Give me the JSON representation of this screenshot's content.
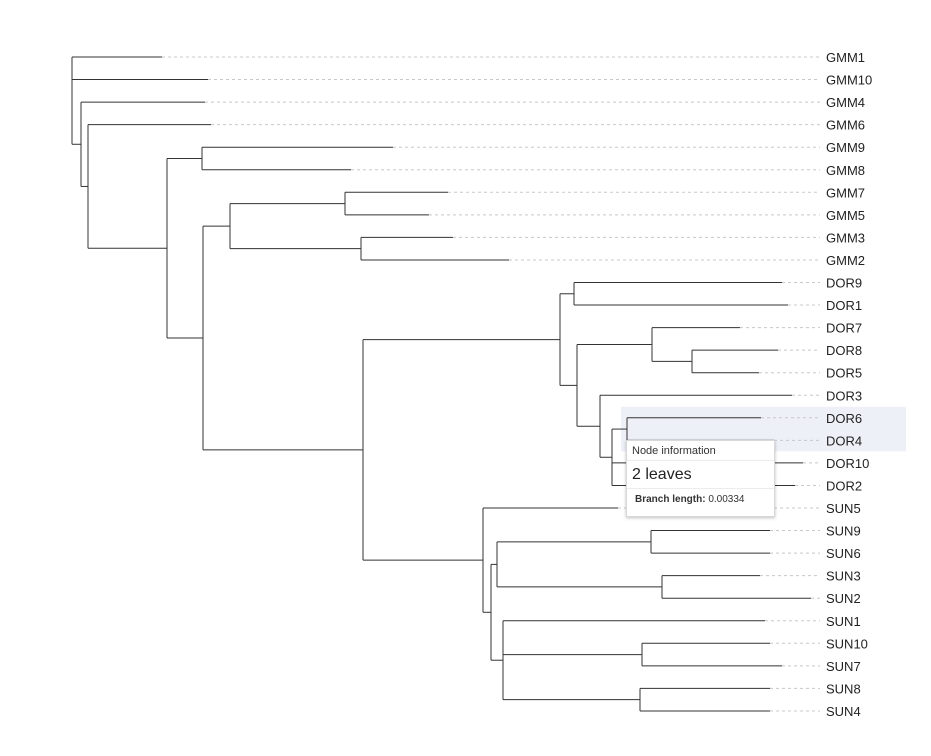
{
  "tree": {
    "leaves": [
      "GMM1",
      "GMM10",
      "GMM4",
      "GMM6",
      "GMM9",
      "GMM8",
      "GMM7",
      "GMM5",
      "GMM3",
      "GMM2",
      "DOR9",
      "DOR1",
      "DOR7",
      "DOR8",
      "DOR5",
      "DOR3",
      "DOR6",
      "DOR4",
      "DOR10",
      "DOR2",
      "SUN5",
      "SUN9",
      "SUN6",
      "SUN3",
      "SUN2",
      "SUN1",
      "SUN10",
      "SUN7",
      "SUN8",
      "SUN4"
    ],
    "highlighted_leaves": [
      "DOR6",
      "DOR4"
    ],
    "colors": {
      "branch": "#333333",
      "guide": "#c8c8c8",
      "highlight": "#eef0f8"
    }
  },
  "tooltip": {
    "title": "Node information",
    "leaves_text": "2 leaves",
    "branch_length_label": "Branch length:",
    "branch_length_value": "0.00334"
  }
}
